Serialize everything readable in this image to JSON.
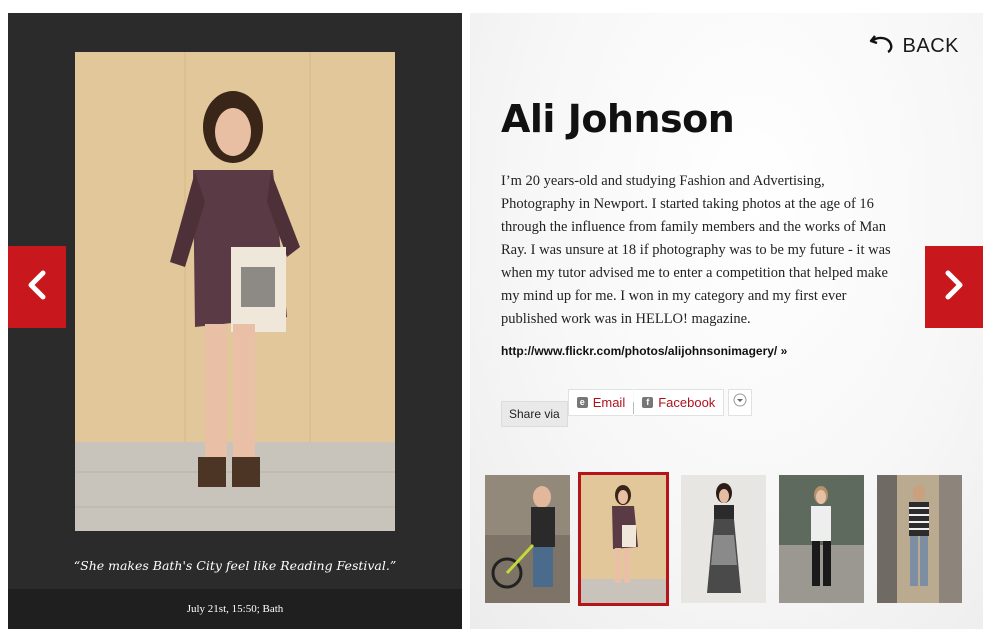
{
  "colors": {
    "accent_red": "#c8181e",
    "panel_dark": "#2b2b2b",
    "selected_border": "#b6141b"
  },
  "photo": {
    "caption": "“She makes Bath's City feel like Reading Festival.”",
    "date": "July 21st, 15:50; Bath"
  },
  "nav": {
    "back_label": "BACK",
    "prev_icon": "chevron-left-icon",
    "next_icon": "chevron-right-icon"
  },
  "profile": {
    "name": "Ali Johnson",
    "bio": "I’m 20 years-old and studying Fashion and Advertising, Photography in Newport. I started taking photos at the age of 16 through the influence from family members and the works of Man Ray. I was unsure at 18 if photography was to be my future - it was when my tutor advised me to enter a competition that helped make my mind up for me. I won in my category and my first ever published work was in HELLO! magazine.",
    "link": "http://www.flickr.com/photos/alijohnsonimagery/ »"
  },
  "share": {
    "label": "Share via",
    "email": "Email",
    "facebook": "Facebook",
    "more_icon": "chevron-down-icon"
  },
  "thumbnails": [
    {
      "selected": false
    },
    {
      "selected": true
    },
    {
      "selected": false
    },
    {
      "selected": false
    },
    {
      "selected": false
    }
  ]
}
